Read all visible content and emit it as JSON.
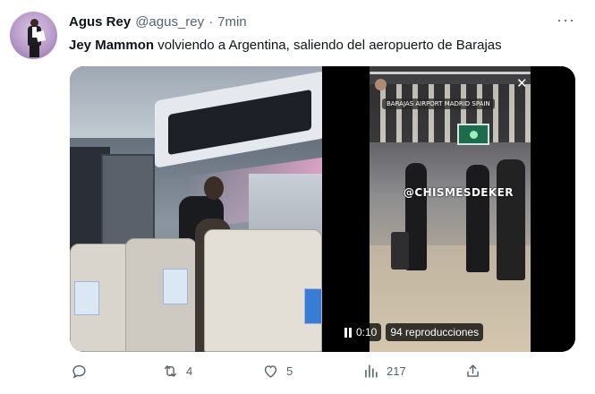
{
  "tweet": {
    "author_name": "Agus Rey",
    "author_handle": "@agus_rey",
    "separator": "·",
    "time": "7min",
    "more_label": "···",
    "text_mention": "Jey Mammon",
    "text_body": " volviendo a Argentina, saliendo del aeropuerto de Barajas"
  },
  "media": {
    "video": {
      "watermark": "@CHISMESDEKER",
      "story_location": "BARAJAS AIRPORT MADRID SPAIN",
      "elapsed": "0:10",
      "views_label": "94 reproducciones"
    }
  },
  "actions": {
    "reply": {
      "icon": "reply-icon",
      "count": ""
    },
    "retweet": {
      "icon": "retweet-icon",
      "count": "4"
    },
    "like": {
      "icon": "heart-icon",
      "count": "5"
    },
    "views": {
      "icon": "views-chart-icon",
      "count": "217"
    },
    "share": {
      "icon": "share-icon"
    }
  },
  "colors": {
    "text_primary": "#0f1419",
    "text_secondary": "#536471",
    "background": "#ffffff"
  }
}
